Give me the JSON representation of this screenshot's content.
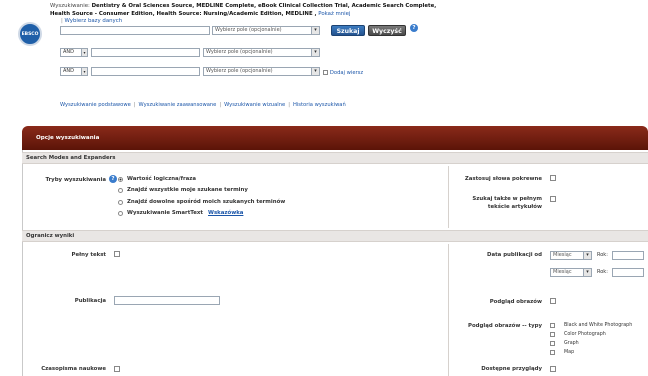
{
  "header": {
    "logo_text": "EBSCO",
    "searching_prefix": "Wyszukiwanie:",
    "databases": "Dentistry & Oral Sciences Source, MEDLINE Complete, eBook Clinical Collection Trial, Academic Search Complete, Health Source - Consumer Edition, Health Source: Nursing/Academic Edition, MEDLINE ,",
    "show_more": "Pokaż mniej",
    "choose_databases": "Wybierz bazy danych"
  },
  "search": {
    "field_placeholder": "Wybierz pole (opcjonalnie)",
    "operators": [
      "AND",
      "AND"
    ],
    "search_button": "Szukaj",
    "clear_button": "Wyczyść",
    "add_row": "Dodaj wiersz"
  },
  "nav_links": [
    "Wyszukiwanie podstawowe",
    "Wyszukiwanie zaawansowane",
    "Wyszukiwanie wizualne",
    "Historia wyszukiwań"
  ],
  "panel": {
    "title": "Opcje wyszukiwania",
    "modes_section": "Search Modes and Expanders",
    "modes_label": "Tryby wyszukiwania",
    "modes": [
      "Wartość logiczna/fraza",
      "Znajdź wszystkie moje szukane terminy",
      "Znajdź dowolne spośród moich szukanych terminów",
      "Wyszukiwanie SmartText"
    ],
    "smarttext_hint": "Wskazówka",
    "apply_related": "Zastosuj słowa pokrewne",
    "search_fulltext": "Szukaj także w pełnym tekście artykułów",
    "limit_section": "Ogranicz wyniki",
    "full_text": "Pełny tekst",
    "publication": "Publikacja",
    "scholarly": "Czasopisma naukowe",
    "pub_date_from": "Data publikacji od",
    "month_placeholder": "Miesiąc",
    "year_label": "Rok:",
    "image_preview": "Podgląd obrazów",
    "image_types_label": "Podgląd obrazów -- typy",
    "image_types": [
      "Black and White Photograph",
      "Color Photograph",
      "Graph",
      "Map"
    ],
    "available_previews": "Dostępne przyglądy"
  }
}
